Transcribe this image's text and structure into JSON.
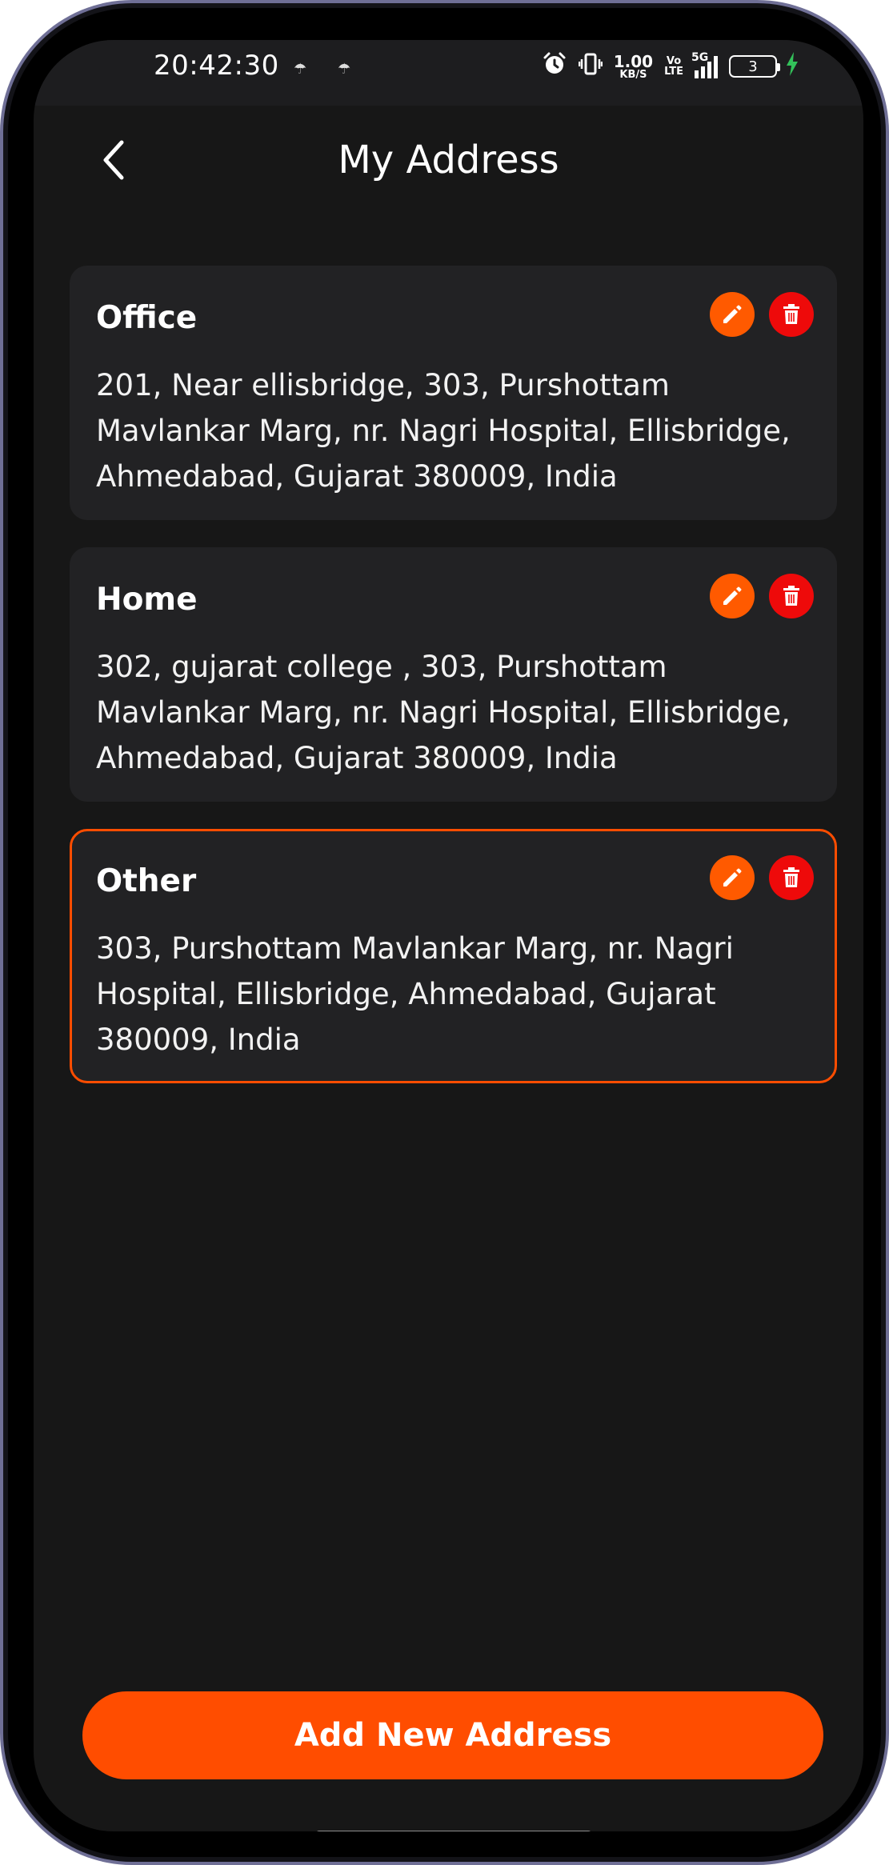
{
  "status_bar": {
    "time": "20:42:30",
    "left_icons": [
      "cloud-icon",
      "cloud-icon"
    ],
    "speed_value": "1.00",
    "speed_unit": "KB/S",
    "volte_top": "Vo",
    "volte_bottom": "LTE",
    "network_type": "5G",
    "battery_level": "3",
    "icons": [
      "alarm-icon",
      "vibrate-icon",
      "signal-icon",
      "battery-icon",
      "charging-icon"
    ]
  },
  "header": {
    "title": "My Address",
    "back_icon": "chevron-left-icon"
  },
  "addresses": [
    {
      "label": "Office",
      "address": "201, Near ellisbridge, 303, Purshottam Mavlankar Marg, nr. Nagri Hospital, Ellisbridge, Ahmedabad, Gujarat 380009, India",
      "selected": false
    },
    {
      "label": "Home",
      "address": "302, gujarat college , 303, Purshottam Mavlankar Marg, nr. Nagri Hospital, Ellisbridge, Ahmedabad, Gujarat 380009, India",
      "selected": false
    },
    {
      "label": "Other",
      "address": "303, Purshottam Mavlankar Marg, nr. Nagri Hospital, Ellisbridge, Ahmedabad, Gujarat 380009, India",
      "selected": true
    }
  ],
  "add_button": {
    "label": "Add New Address"
  },
  "colors": {
    "accent": "#ff4d00",
    "edit": "#ff5a00",
    "delete": "#ee0a0a",
    "background": "#171717",
    "card": "#222224"
  }
}
